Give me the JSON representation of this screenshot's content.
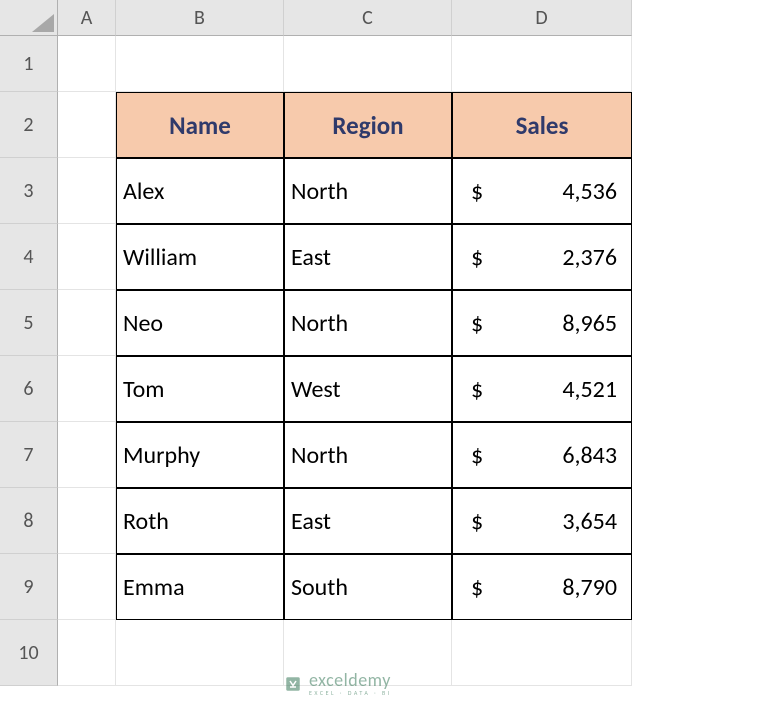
{
  "columns": [
    "A",
    "B",
    "C",
    "D"
  ],
  "rows": [
    "1",
    "2",
    "3",
    "4",
    "5",
    "6",
    "7",
    "8",
    "9",
    "10"
  ],
  "table": {
    "headers": [
      "Name",
      "Region",
      "Sales"
    ],
    "data": [
      {
        "name": "Alex",
        "region": "North",
        "currency": "$",
        "amount": "4,536"
      },
      {
        "name": "William",
        "region": "East",
        "currency": "$",
        "amount": "2,376"
      },
      {
        "name": "Neo",
        "region": "North",
        "currency": "$",
        "amount": "8,965"
      },
      {
        "name": "Tom",
        "region": "West",
        "currency": "$",
        "amount": "4,521"
      },
      {
        "name": "Murphy",
        "region": "North",
        "currency": "$",
        "amount": "6,843"
      },
      {
        "name": "Roth",
        "region": "East",
        "currency": "$",
        "amount": "3,654"
      },
      {
        "name": "Emma",
        "region": "South",
        "currency": "$",
        "amount": "8,790"
      }
    ]
  },
  "watermark": {
    "main": "exceldemy",
    "sub": "EXCEL · DATA · BI"
  },
  "chart_data": {
    "type": "table",
    "title": "",
    "columns": [
      "Name",
      "Region",
      "Sales"
    ],
    "rows": [
      [
        "Alex",
        "North",
        4536
      ],
      [
        "William",
        "East",
        2376
      ],
      [
        "Neo",
        "North",
        8965
      ],
      [
        "Tom",
        "West",
        4521
      ],
      [
        "Murphy",
        "North",
        6843
      ],
      [
        "Roth",
        "East",
        3654
      ],
      [
        "Emma",
        "South",
        8790
      ]
    ]
  }
}
